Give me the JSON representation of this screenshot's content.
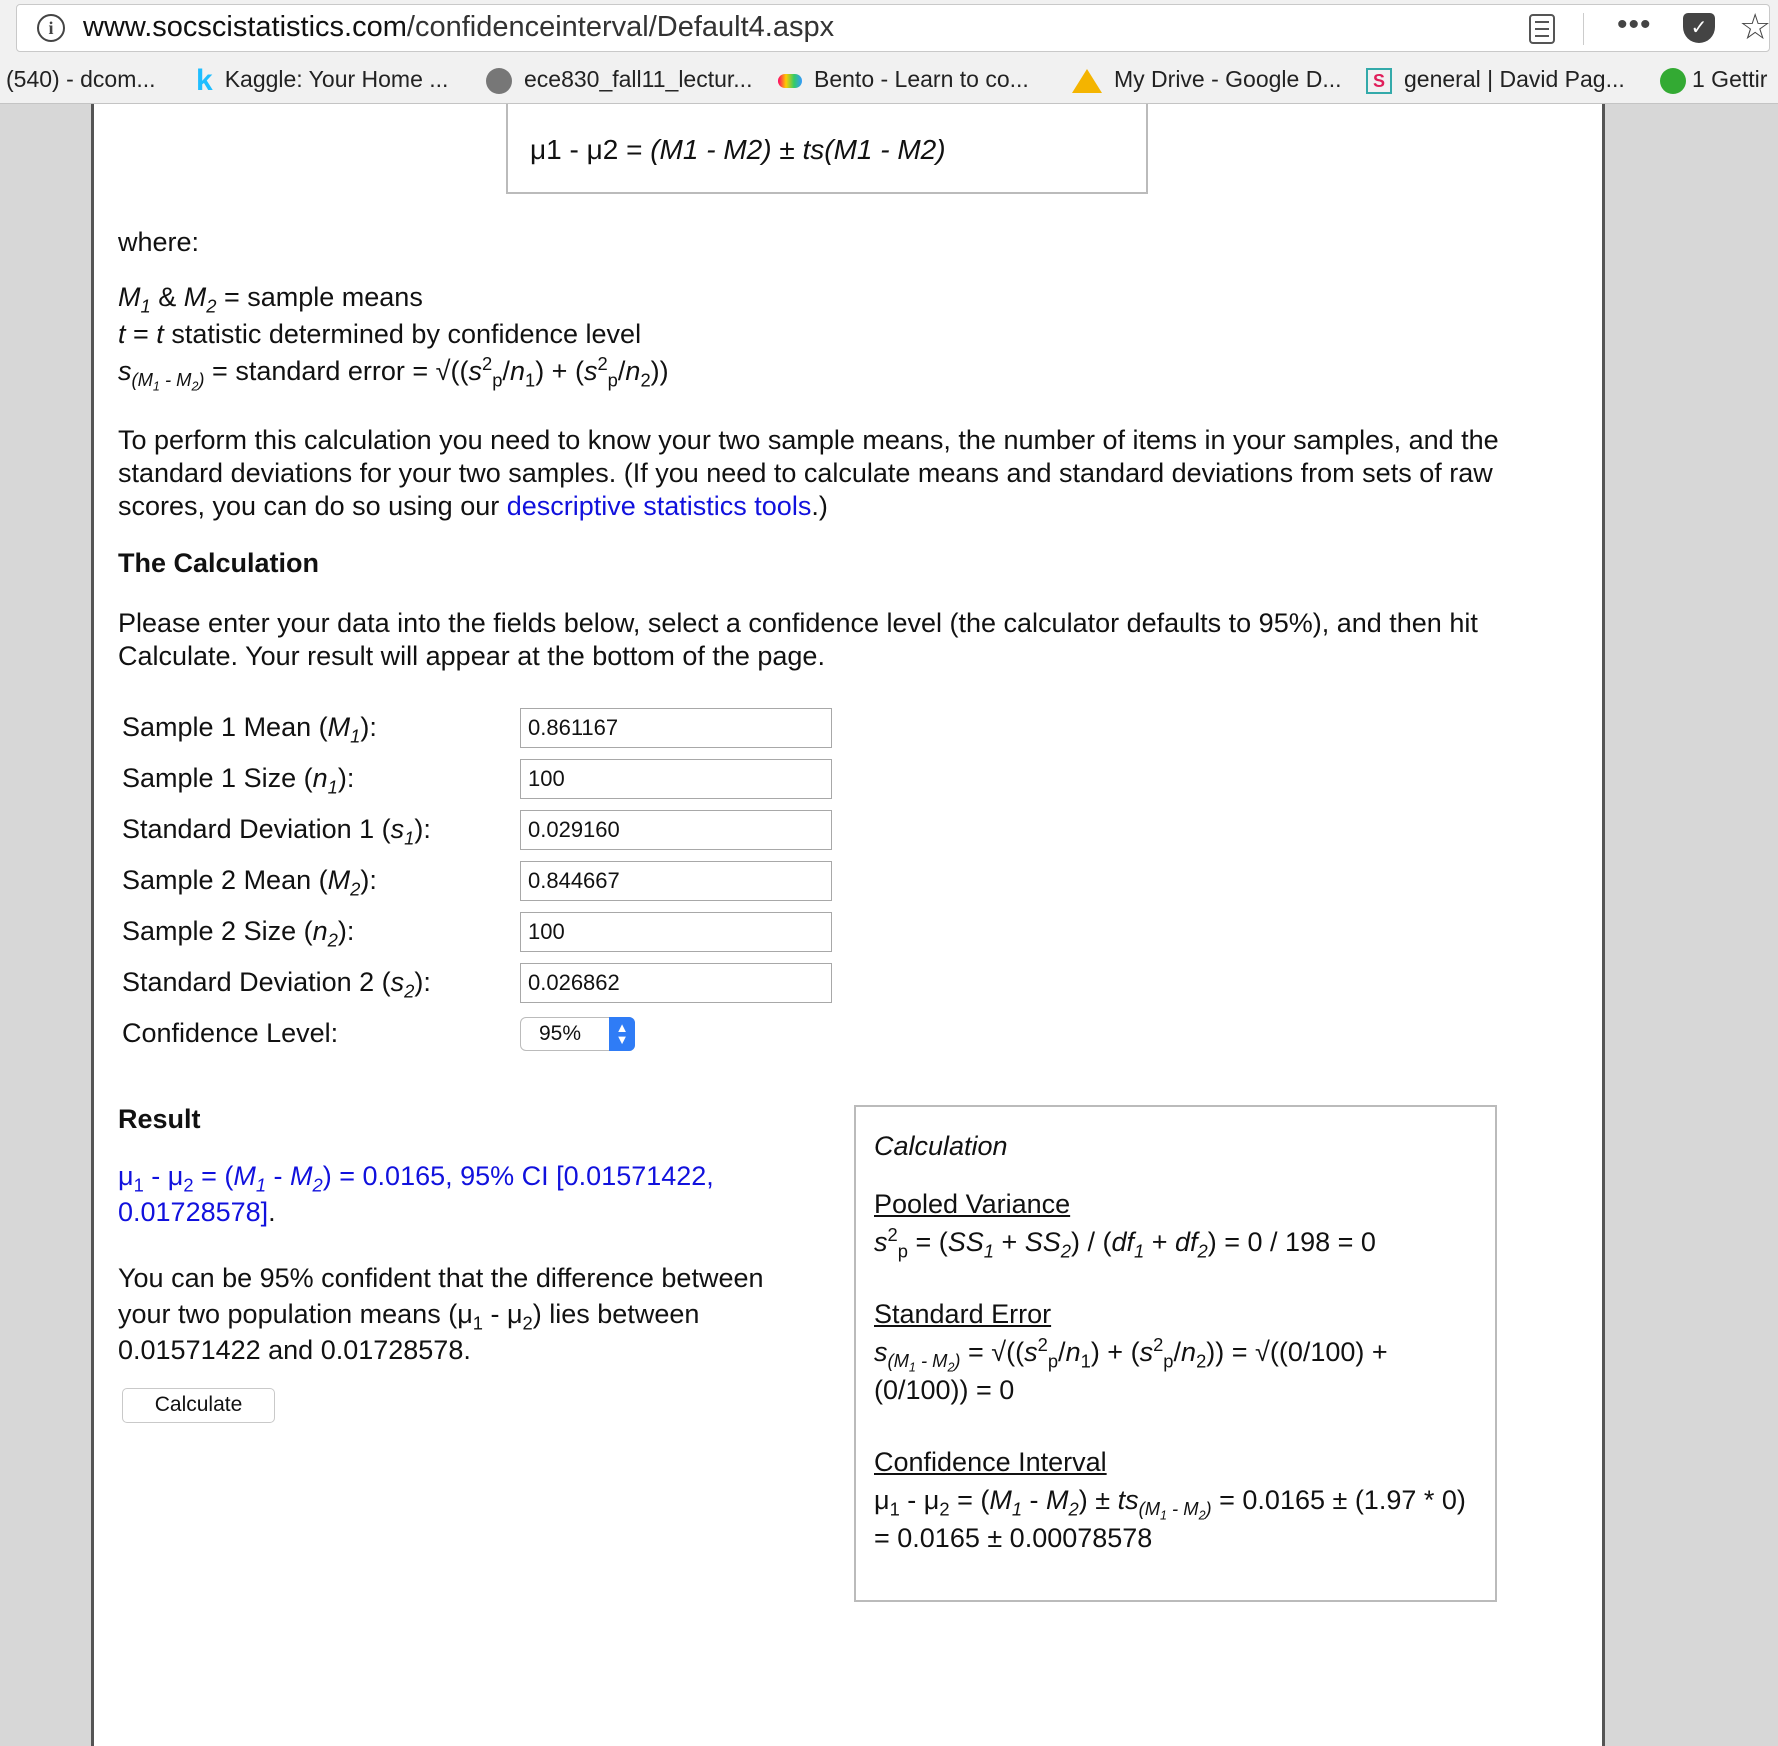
{
  "browser": {
    "url_host": "www.socscistatistics.com",
    "url_path": "/confidenceinterval/Default4.aspx",
    "menu_dots": "•••",
    "bookmarks": [
      {
        "label": "(540) - dcom...",
        "icon": "none"
      },
      {
        "label": "Kaggle: Your Home ...",
        "icon": "kaggle-icon"
      },
      {
        "label": "ece830_fall11_lectur...",
        "icon": "globe-icon"
      },
      {
        "label": "Bento - Learn to co...",
        "icon": "bento-icon"
      },
      {
        "label": "My Drive - Google D...",
        "icon": "google-drive-icon"
      },
      {
        "label": "general | David Pag...",
        "icon": "slack-icon"
      },
      {
        "label": "1 Gettir",
        "icon": "green-icon"
      }
    ]
  },
  "formula": {
    "lhs": "μ1 - μ2 =",
    "rhs": "(M1 - M2) ± ts(M1 - M2)"
  },
  "where_label": "where:",
  "definitions": {
    "means": "= sample means",
    "t_stat": "statistic determined by confidence level",
    "std_err": "= standard error ="
  },
  "intro": {
    "text_before": "To perform this calculation you need to know your two sample means, the number of items in your samples, and the standard deviations for your two samples. (If you need to calculate means and standard deviations from sets of raw scores, you can do so using our ",
    "link": "descriptive statistics tools",
    "text_after": ".)"
  },
  "calc_heading": "The Calculation",
  "instructions": "Please enter your data into the fields below, select a confidence level (the calculator defaults to 95%), and then hit Calculate. Your result will appear at the bottom of the page.",
  "form": {
    "fields": [
      {
        "label": "Sample 1 Mean",
        "symbol": "M",
        "sub": "1",
        "value": "0.861167"
      },
      {
        "label": "Sample 1 Size",
        "symbol": "n",
        "sub": "1",
        "value": "100"
      },
      {
        "label": "Standard Deviation 1",
        "symbol": "s",
        "sub": "1",
        "value": "0.029160"
      },
      {
        "label": "Sample 2 Mean",
        "symbol": "M",
        "sub": "2",
        "value": "0.844667"
      },
      {
        "label": "Sample 2 Size",
        "symbol": "n",
        "sub": "2",
        "value": "100"
      },
      {
        "label": "Standard Deviation 2",
        "symbol": "s",
        "sub": "2",
        "value": "0.026862"
      }
    ],
    "confidence_label": "Confidence Level:",
    "confidence_value": "95%"
  },
  "result": {
    "heading": "Result",
    "ci_value": "= 0.0165, 95% CI [0.01571422, 0.01728578]",
    "confidence_statement_1": "You can be 95% confident that the difference between your two population means",
    "confidence_statement_2": "lies between 0.01571422 and 0.01728578.",
    "calculate_button": "Calculate"
  },
  "calculation_box": {
    "title": "Calculation",
    "pooled_variance_heading": "Pooled Variance",
    "pooled_variance_result": "= 0 / 198 = 0",
    "standard_error_heading": "Standard Error",
    "standard_error_result": "√((0/100) + (0/100)) = 0",
    "ci_heading": "Confidence Interval",
    "ci_result": "= 0.0165 ± (1.97 * 0) = 0.0165 ± 0.00078578"
  },
  "colors": {
    "link_blue": "#1111dd",
    "select_accent": "#2f7cf6"
  }
}
